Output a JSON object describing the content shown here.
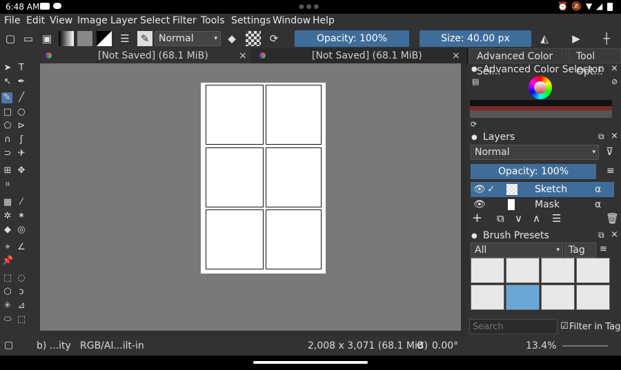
{
  "status": {
    "time": "6:48 AM"
  },
  "menu": [
    "File",
    "Edit",
    "View",
    "Image",
    "Layer",
    "Select",
    "Filter",
    "Tools",
    "Settings",
    "Window",
    "Help"
  ],
  "toolbar": {
    "blend_mode": "Normal",
    "opacity": "Opacity: 100%",
    "size": "Size: 40.00 px"
  },
  "tabs": [
    {
      "label": "[Not Saved]  (68.1 MiB)",
      "close": "×"
    },
    {
      "label": "[Not Saved]  (68.1 MiB)",
      "close": "×"
    }
  ],
  "dock": {
    "tabs": [
      "Advanced Color Sel...",
      "Tool Opt..."
    ],
    "color_title": "Advanced Color Selector",
    "layers_title": "Layers",
    "layers_blend": "Normal",
    "layers_opacity": "Opacity:  100%",
    "layers": [
      {
        "name": "Sketch",
        "selected": true
      },
      {
        "name": "Mask",
        "selected": false
      }
    ],
    "brush_title": "Brush Presets",
    "brush_filter": "All",
    "tag_label": "Tag",
    "search_placeholder": "Search",
    "filter_in_tag": "Filter in Tag"
  },
  "bottom": {
    "brush_name": "b) ...ity",
    "color_space": "RGB/Al...ilt-in",
    "dimensions": "2,008 x 3,071 (68.1 MiB)",
    "rotation": "0.00°",
    "zoom": "13.4%"
  },
  "colors": {
    "accent": "#3f6d9a",
    "bg": "#323232",
    "canvas": "#797979"
  }
}
